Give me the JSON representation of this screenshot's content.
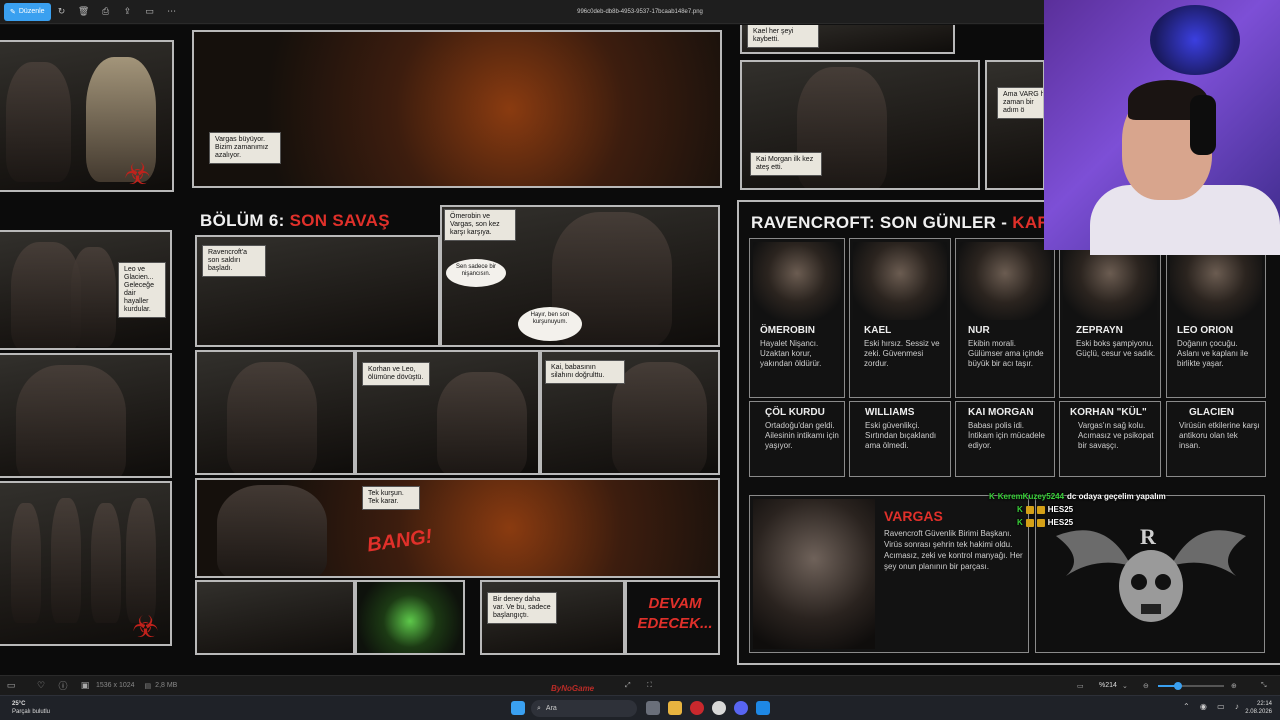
{
  "toolbar": {
    "edit_label": "Düzenle",
    "filename": "996c0deb-db8b-4953-9537-17bcaab148e7.png"
  },
  "comic": {
    "top_captions": {
      "vargas_grows": "Vargas büyüyor. Bizim zamanımız azalıyor.",
      "kael_lost": "Kael her şeyi kaybetti.",
      "ama_varg": "Ama VARG her zaman bir adım ö",
      "kai_morgan": "Kai Morgan ilk kez ateş etti."
    },
    "left_captions": {
      "leo_glacien": "Leo ve Glacien... Geleceğe dair hayaller kurdular."
    },
    "chapter": {
      "prefix": "BÖLÜM 6:",
      "title": "SON SAVAŞ",
      "cap_attack": "Ravencroft'a son saldırı başladı.",
      "cap_omerobin": "Ömerobin ve Vargas, son kez karşı karşıya.",
      "bubble_sniper": "Sen sadece bir nişancısın.",
      "bubble_reply": "Hayır, ben son kurşunuyum.",
      "cap_korhan": "Korhan ve Leo, ölümüne dövüştü.",
      "cap_kai": "Kai, babasının silahını doğrulttu.",
      "cap_shot": "Tek kurşun. Tek karar.",
      "bang": "BANG!",
      "cap_experiment": "Bir deney daha var. Ve bu, sadece başlangıçtı.",
      "devam": "DEVAM EDECEK..."
    },
    "characters": {
      "heading_prefix": "RAVENCROFT: SON GÜNLER -",
      "heading_red": "KARAKTE",
      "row1": [
        {
          "name": "ÖMEROBIN",
          "desc": "Hayalet Nişancı. Uzaktan korur, yakından öldürür."
        },
        {
          "name": "KAEL",
          "desc": "Eski hırsız. Sessiz ve zeki. Güvenmesi zordur."
        },
        {
          "name": "NUR",
          "desc": "Ekibin morali. Gülümser ama içinde büyük bir acı taşır."
        },
        {
          "name": "ZEPRAYN",
          "desc": "Eski boks şampiyonu. Güçlü, cesur ve sadık."
        },
        {
          "name": "LEO ORION",
          "desc": "Doğanın çocuğu. Aslanı ve kaplanı ile birlikte yaşar."
        }
      ],
      "row2": [
        {
          "name": "ÇÖL KURDU",
          "desc": "Ortadoğu'dan geldi. Ailesinin intikamı için yaşıyor."
        },
        {
          "name": "WILLIAMS",
          "desc": "Eski güvenlikçi. Sırtından bıçaklandı ama ölmedi."
        },
        {
          "name": "KAI MORGAN",
          "desc": "Babası polis idi. İntikam için mücadele ediyor."
        },
        {
          "name": "KORHAN \"KÜL\"",
          "desc": "Vargas'ın sağ kolu. Acımasız ve psikopat bir savaşçı."
        },
        {
          "name": "GLACIEN",
          "desc": "Virüsün etkilerine karşı antikoru olan tek insan."
        }
      ],
      "villain": {
        "name": "VARGAS",
        "desc": "Ravencroft Güvenlik Birimi Başkanı. Virüs sonrası şehrin tek hakimi oldu. Acımasız, zeki ve kontrol manyağı. Her şey onun planının bir parçası.",
        "emblem_letter": "R"
      }
    }
  },
  "chat": [
    {
      "user": "KeremKuzey5244",
      "message": "dc odaya geçelim yapalım"
    },
    {
      "user": "",
      "message": "HES25"
    },
    {
      "user": "",
      "message": "HES25"
    }
  ],
  "viewer_status": {
    "dimensions": "1536 x 1024",
    "file_size": "2,8 MB",
    "zoom": "%214",
    "zoom_fraction": 0.3
  },
  "watermark": "ByNoGame",
  "taskbar": {
    "weather_temp": "25°C",
    "weather_desc": "Parçalı bulutlu",
    "search_placeholder": "Ara",
    "time": "22:14",
    "date": "2.08.2026"
  }
}
